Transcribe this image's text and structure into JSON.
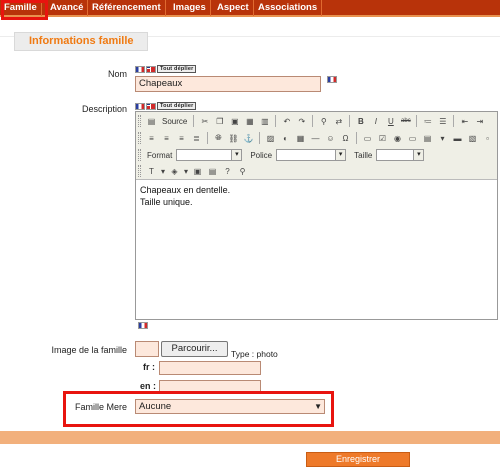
{
  "tabs": [
    {
      "label": "Famille"
    },
    {
      "label": "Avancé"
    },
    {
      "label": "Référencement"
    },
    {
      "label": "Images"
    },
    {
      "label": "Aspect"
    },
    {
      "label": "Associations"
    }
  ],
  "section": {
    "title": "Informations famille"
  },
  "form": {
    "nom": {
      "label": "Nom",
      "value": "Chapeaux",
      "lang_selector": "Tout déplier"
    },
    "description": {
      "label": "Description",
      "lang_selector": "Tout déplier",
      "toolbar": {
        "source_label": "Source",
        "format_label": "Format",
        "police_label": "Police",
        "taille_label": "Taille"
      },
      "content_lines": [
        "Chapeaux en dentelle.",
        "Taille unique."
      ]
    },
    "image": {
      "label": "Image de la famille",
      "browse_label": "Parcourir...",
      "type_text": "Type : photo",
      "fr_label": "fr :",
      "en_label": "en :"
    },
    "famille_mere": {
      "label": "Famille Mere",
      "selected": "Aucune"
    }
  },
  "actions": {
    "save_label": "Enregistrer"
  },
  "colors": {
    "tab_bar": "#b8330a",
    "accent": "#f07a12",
    "highlight": "#e8140f",
    "input_bg": "#fde8dc"
  }
}
